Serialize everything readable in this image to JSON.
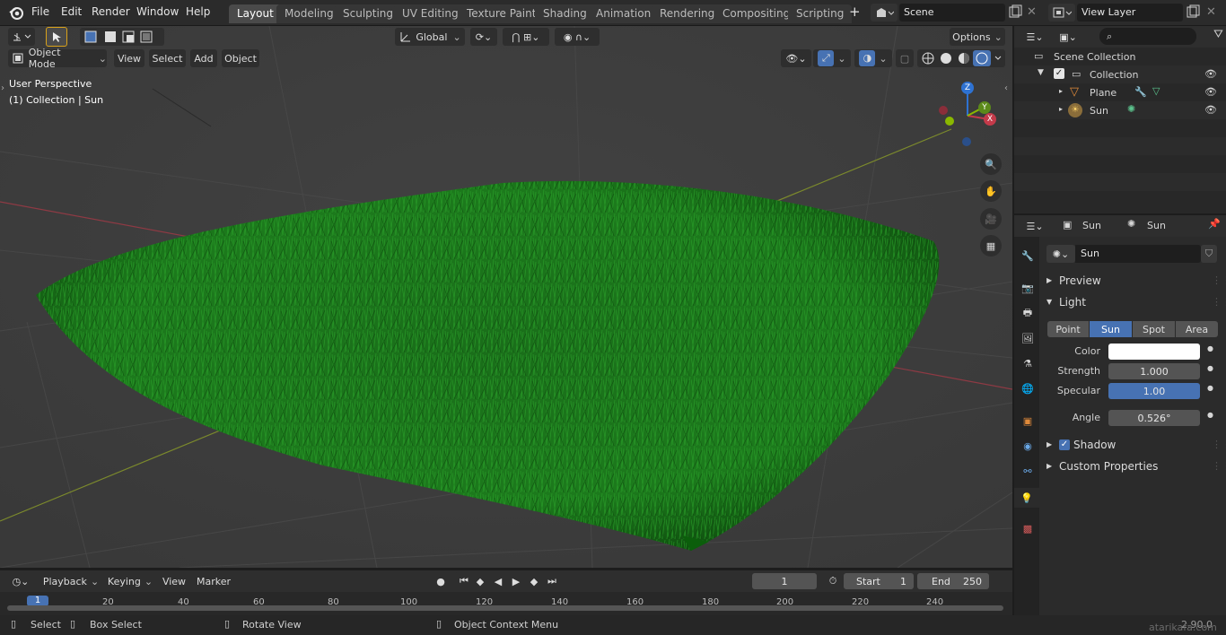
{
  "topbar": {
    "menus": [
      "File",
      "Edit",
      "Render",
      "Window",
      "Help"
    ],
    "workspaces": [
      "Layout",
      "Modeling",
      "Sculpting",
      "UV Editing",
      "Texture Paint",
      "Shading",
      "Animation",
      "Rendering",
      "Compositing",
      "Scripting"
    ],
    "active_workspace": "Layout",
    "add_tab": "+",
    "scene": "Scene",
    "view_layer": "View Layer"
  },
  "viewport": {
    "orientation": "Global",
    "options": "Options",
    "mode": "Object Mode",
    "menus": [
      "View",
      "Select",
      "Add",
      "Object"
    ],
    "overlay_title": "User Perspective",
    "overlay_sub": "(1) Collection | Sun",
    "gizmo": {
      "z": "Z",
      "y": "Y",
      "x": "X"
    }
  },
  "outliner": {
    "search_placeholder": "",
    "root": "Scene Collection",
    "collection": "Collection",
    "items": [
      {
        "name": "Plane"
      },
      {
        "name": "Sun"
      }
    ]
  },
  "properties": {
    "breadcrumb_object": "Sun",
    "breadcrumb_data": "Sun",
    "datablock": "Sun",
    "preview": "Preview",
    "light": "Light",
    "types": [
      "Point",
      "Sun",
      "Spot",
      "Area"
    ],
    "active_type": "Sun",
    "color_label": "Color",
    "color_value": "#ffffff",
    "strength_label": "Strength",
    "strength": "1.000",
    "specular_label": "Specular",
    "specular": "1.00",
    "angle_label": "Angle",
    "angle": "0.526°",
    "shadow": "Shadow",
    "custom_props": "Custom Properties"
  },
  "timeline": {
    "menus": [
      "Playback",
      "Keying",
      "View",
      "Marker"
    ],
    "current_frame": "1",
    "start_label": "Start",
    "start": "1",
    "end_label": "End",
    "end": "250",
    "ruler": [
      "1",
      "20",
      "40",
      "60",
      "80",
      "100",
      "120",
      "140",
      "160",
      "180",
      "200",
      "220",
      "240"
    ]
  },
  "statusbar": {
    "select": "Select",
    "box_select": "Box Select",
    "rotate": "Rotate View",
    "context": "Object Context Menu",
    "version": "2.90.0",
    "watermark": "atarikafa.com"
  },
  "colors": {
    "accent": "#4772b3",
    "grass": "#1f7a1f",
    "axis_x": "#c43a4a",
    "axis_y": "#8ab800",
    "axis_z": "#2e72d2"
  }
}
